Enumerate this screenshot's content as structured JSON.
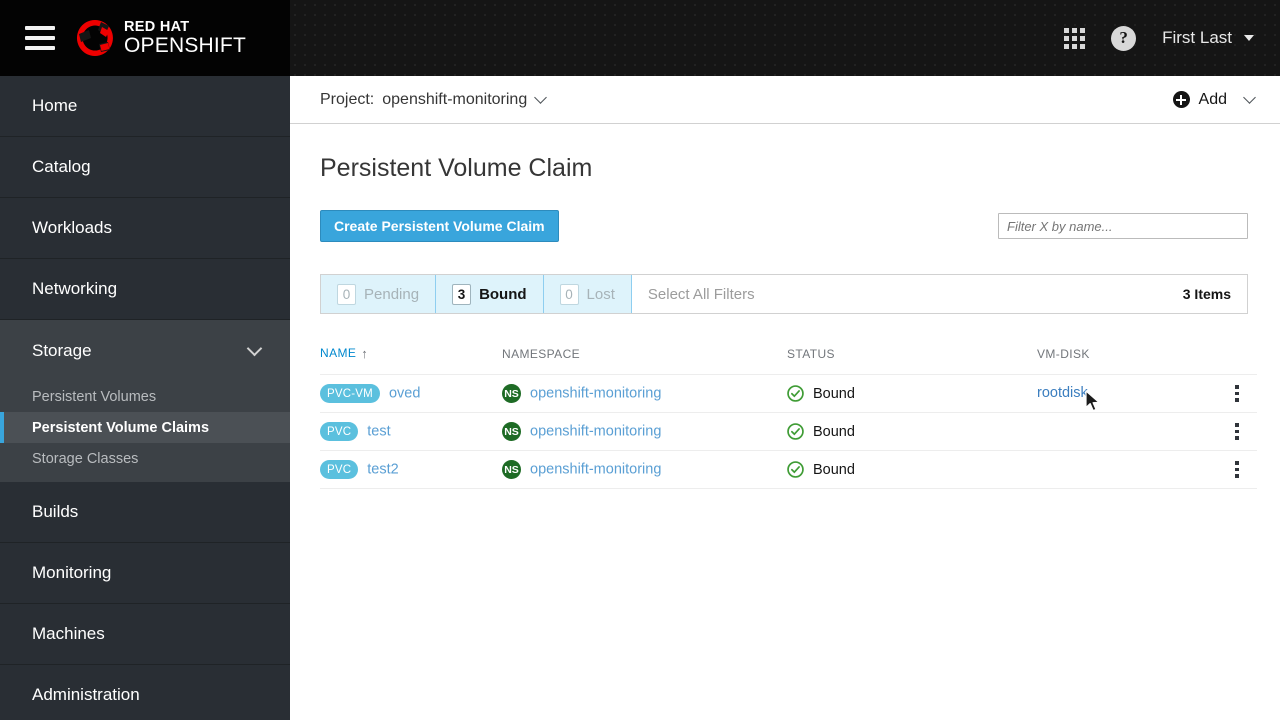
{
  "masthead": {
    "menu_icon": "hamburger-icon",
    "logo_line1": "RED HAT",
    "logo_line2": "OPENSHIFT",
    "apps_icon": "grid-icon",
    "help_icon": "help-icon",
    "user_name": "First Last"
  },
  "project_bar": {
    "label": "Project:",
    "project": "openshift-monitoring",
    "add_label": "Add"
  },
  "sidebar": {
    "items": [
      {
        "label": "Home"
      },
      {
        "label": "Catalog"
      },
      {
        "label": "Workloads"
      },
      {
        "label": "Networking"
      }
    ],
    "storage": {
      "label": "Storage",
      "expanded": true,
      "items": [
        {
          "label": "Persistent Volumes",
          "active": false
        },
        {
          "label": "Persistent Volume Claims",
          "active": true
        },
        {
          "label": "Storage Classes",
          "active": false
        }
      ]
    },
    "items_after": [
      {
        "label": "Builds"
      },
      {
        "label": "Monitoring"
      },
      {
        "label": "Machines"
      },
      {
        "label": "Administration"
      }
    ]
  },
  "page": {
    "title": "Persistent Volume Claim",
    "create_button": "Create Persistent Volume Claim",
    "filter_placeholder": "Filter X by name..."
  },
  "filters": {
    "segments": [
      {
        "count": "0",
        "label": "Pending",
        "active": false
      },
      {
        "count": "3",
        "label": "Bound",
        "active": true
      },
      {
        "count": "0",
        "label": "Lost",
        "active": false
      }
    ],
    "select_all": "Select All Filters",
    "items_count": "3 Items"
  },
  "table": {
    "columns": [
      {
        "label": "NAME",
        "sorted": true,
        "sort_dir": "↑"
      },
      {
        "label": "NAMESPACE",
        "sorted": false
      },
      {
        "label": "STATUS",
        "sorted": false
      },
      {
        "label": "VM-DISK",
        "sorted": false
      }
    ],
    "rows": [
      {
        "badge": "PVC-VM",
        "name": "oved",
        "ns_badge": "NS",
        "namespace": "openshift-monitoring",
        "status": "Bound",
        "vm_disk": "rootdisk"
      },
      {
        "badge": "PVC",
        "name": "test",
        "ns_badge": "NS",
        "namespace": "openshift-monitoring",
        "status": "Bound",
        "vm_disk": ""
      },
      {
        "badge": "PVC",
        "name": "test2",
        "ns_badge": "NS",
        "namespace": "openshift-monitoring",
        "status": "Bound",
        "vm_disk": ""
      }
    ]
  },
  "colors": {
    "accent_blue": "#39a5dc",
    "link_blue": "#5a9fd4",
    "badge_blue": "#5bc0de",
    "ns_green": "#1e6b25",
    "status_green": "#3f9c35",
    "sidebar_bg": "#292e34",
    "sidebar_section": "#3c4146"
  }
}
